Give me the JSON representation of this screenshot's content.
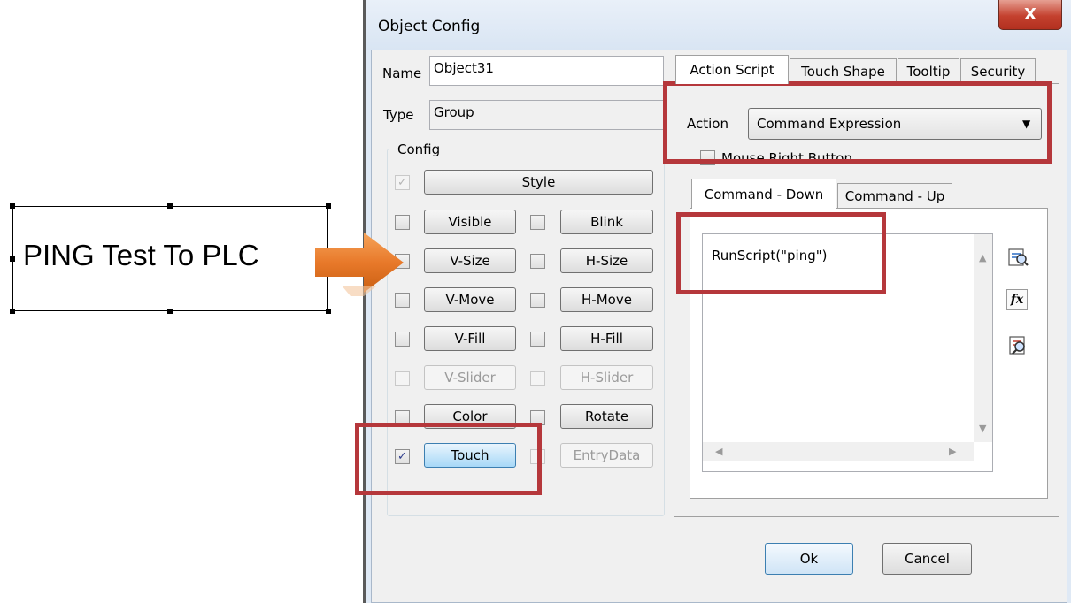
{
  "canvas_object": {
    "text": "PING Test To PLC"
  },
  "dialog": {
    "title": "Object Config",
    "close_label": "X",
    "name_label": "Name",
    "name_value": "Object31",
    "type_label": "Type",
    "type_value": "Group",
    "config_label": "Config",
    "config_items": {
      "style": {
        "label": "Style",
        "checked": true,
        "enabled": false
      },
      "visible": {
        "label": "Visible"
      },
      "blink": {
        "label": "Blink"
      },
      "vsize": {
        "label": "V-Size"
      },
      "hsize": {
        "label": "H-Size"
      },
      "vmove": {
        "label": "V-Move"
      },
      "hmove": {
        "label": "H-Move"
      },
      "vfill": {
        "label": "V-Fill"
      },
      "hfill": {
        "label": "H-Fill"
      },
      "vslider": {
        "label": "V-Slider",
        "enabled": false
      },
      "hslider": {
        "label": "H-Slider",
        "enabled": false
      },
      "color": {
        "label": "Color"
      },
      "rotate": {
        "label": "Rotate"
      },
      "touch": {
        "label": "Touch",
        "checked": true
      },
      "entrydata": {
        "label": "EntryData",
        "enabled": false
      }
    },
    "tabs": [
      "Action Script",
      "Touch Shape",
      "Tooltip",
      "Security"
    ],
    "action_label": "Action",
    "action_value": "Command Expression",
    "mouse_right_label": "Mouse Right Button",
    "sub_tabs": [
      "Command - Down",
      "Command - Up"
    ],
    "script_text": "RunScript(\"ping\")",
    "ok_label": "Ok",
    "cancel_label": "Cancel",
    "check_mark": "✓"
  },
  "colors": {
    "highlight_box": "#b5373b",
    "arrow": "#e8792a"
  }
}
